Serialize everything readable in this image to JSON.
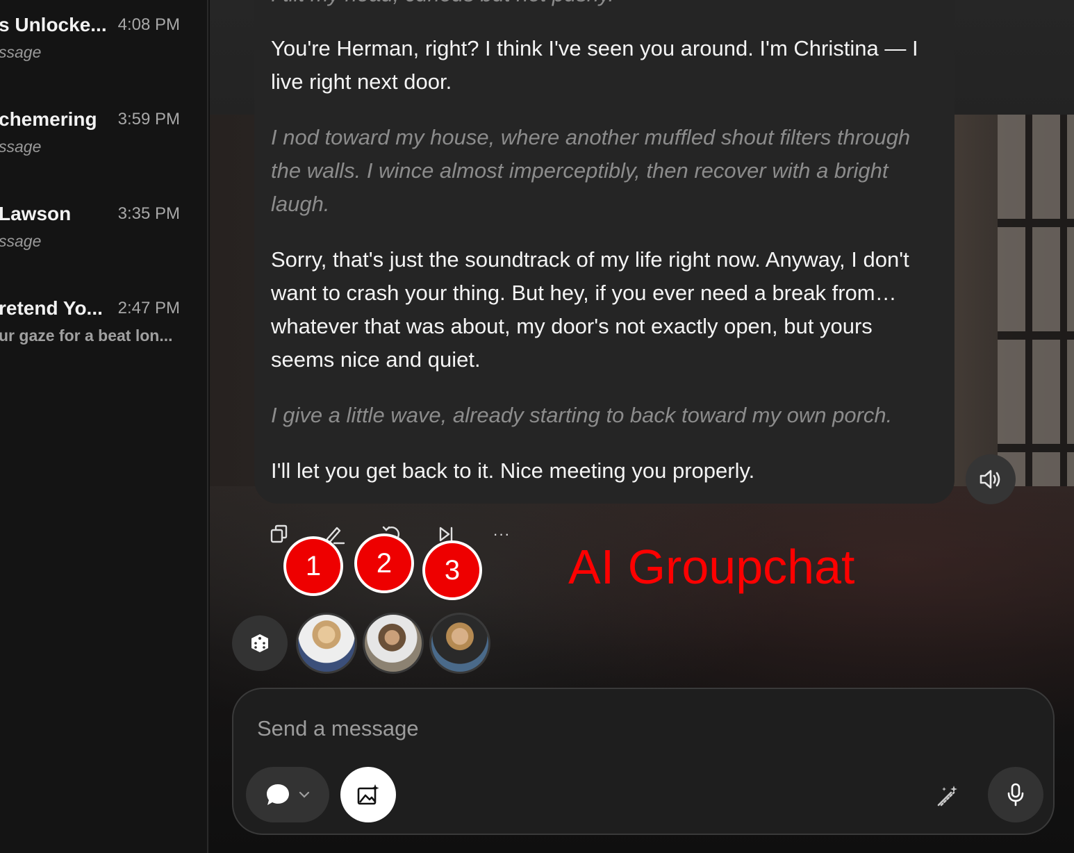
{
  "sidebar": {
    "conversations": [
      {
        "name": "s Unlocke...",
        "time": "4:08 PM",
        "preview": "ssage"
      },
      {
        "name": "chemering",
        "time": "3:59 PM",
        "preview": "ssage"
      },
      {
        "name": "Lawson",
        "time": "3:35 PM",
        "preview": "ssage"
      },
      {
        "name": "retend Yo...",
        "time": "2:47 PM",
        "preview": "ur gaze for a beat lon..."
      }
    ]
  },
  "message": {
    "paragraphs": [
      {
        "type": "action",
        "text": "I tilt my head, curious but not pushy."
      },
      {
        "type": "speech",
        "text": "You're Herman, right? I think I've seen you around. I'm Christina — I live right next door."
      },
      {
        "type": "action",
        "text": "I nod toward my house, where another muffled shout filters through the walls. I wince almost imperceptibly, then recover with a bright laugh."
      },
      {
        "type": "speech",
        "text": "Sorry, that's just the soundtrack of my life right now. Anyway, I don't want to crash your thing. But hey, if you ever need a break from… whatever that was about, my door's not exactly open, but yours seems nice and quiet."
      },
      {
        "type": "action",
        "text": "I give a little wave, already starting to back toward my own porch."
      },
      {
        "type": "speech",
        "text": "I'll let you get back to it. Nice meeting you properly."
      }
    ]
  },
  "actions": {
    "icons": [
      "copy-icon",
      "edit-icon",
      "regenerate-icon",
      "skip-icon",
      "more-icon"
    ],
    "more_label": "···"
  },
  "annotations": {
    "badges": [
      "1",
      "2",
      "3"
    ],
    "label": "AI Groupchat",
    "color": "#ff0000"
  },
  "composer": {
    "placeholder": "Send a message"
  },
  "colors": {
    "bubble": "#252525",
    "action_text": "#8c8c8c",
    "speech_text": "#f4f4f4",
    "badge_fill": "#ee0000"
  }
}
